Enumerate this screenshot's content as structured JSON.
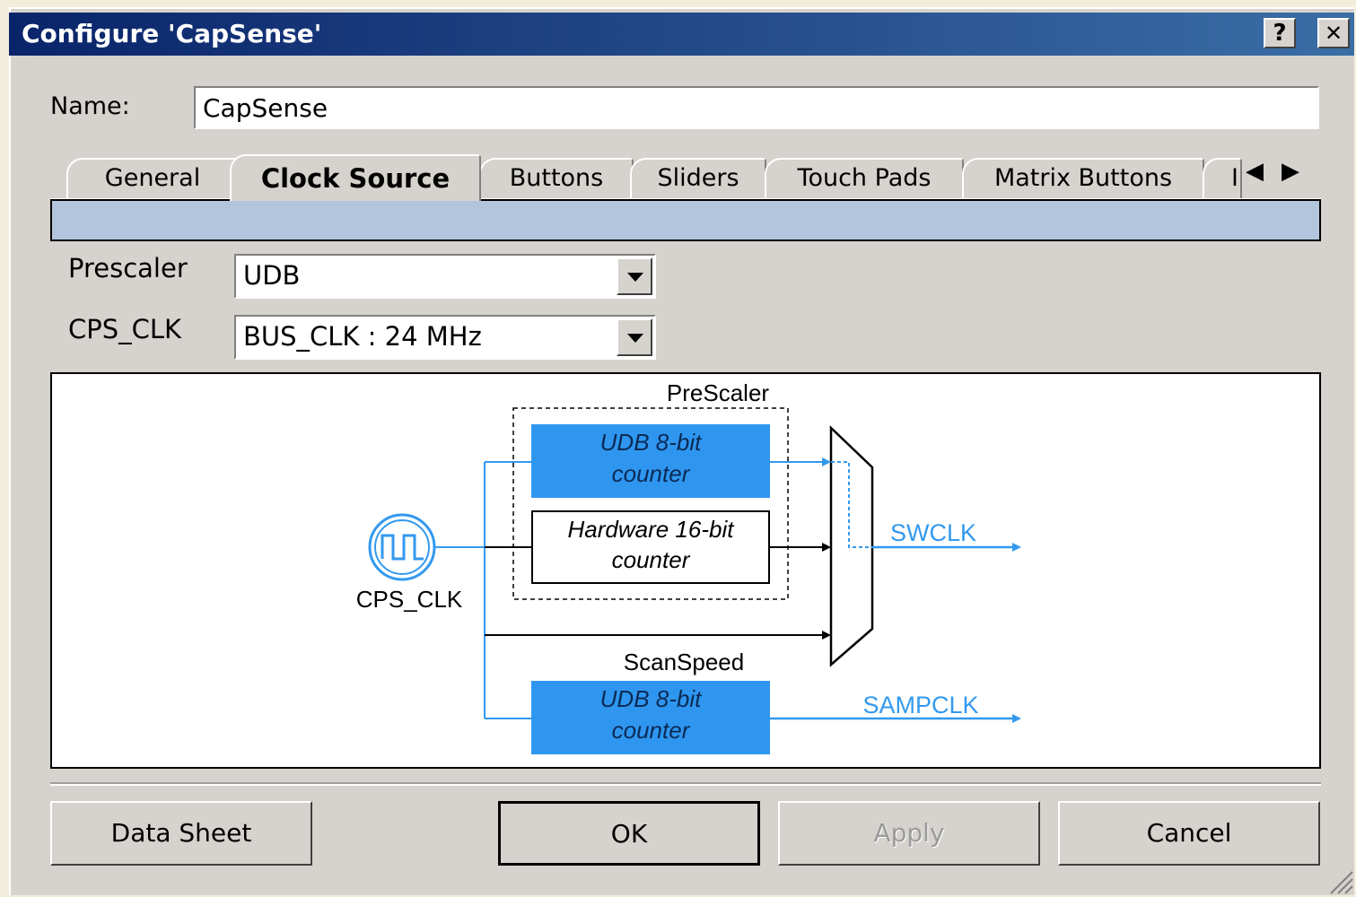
{
  "window": {
    "title": "Configure 'CapSense'",
    "help_button": "?",
    "close_button": "✕"
  },
  "name_field": {
    "label": "Name:",
    "value": "CapSense"
  },
  "tabs": [
    {
      "label": "General",
      "active": false
    },
    {
      "label": "Clock Source",
      "active": true
    },
    {
      "label": "Buttons",
      "active": false
    },
    {
      "label": "Sliders",
      "active": false
    },
    {
      "label": "Touch Pads",
      "active": false
    },
    {
      "label": "Matrix Buttons",
      "active": false
    },
    {
      "label": "I",
      "active": false
    }
  ],
  "tab_scroll": {
    "left": "◀",
    "right": "▶"
  },
  "settings": {
    "prescaler_label": "Prescaler",
    "prescaler_value": "UDB",
    "cps_clk_label": "CPS_CLK",
    "cps_clk_value": "BUS_CLK : 24 MHz"
  },
  "diagram": {
    "prescaler_title": "PreScaler",
    "udb_counter_1_line1": "UDB 8-bit",
    "udb_counter_1_line2": "counter",
    "hw_counter_line1": "Hardware 16-bit",
    "hw_counter_line2": "counter",
    "clock_source_label": "CPS_CLK",
    "swclk_label": "SWCLK",
    "scanspeed_title": "ScanSpeed",
    "udb_counter_2_line1": "UDB 8-bit",
    "udb_counter_2_line2": "counter",
    "sampclk_label": "SAMPCLK",
    "colors": {
      "active_blue": "#3399ee",
      "counter_fill": "#2f96f0",
      "line_black": "#000000"
    }
  },
  "buttons": {
    "data_sheet": "Data Sheet",
    "ok": "OK",
    "apply": "Apply",
    "cancel": "Cancel"
  }
}
